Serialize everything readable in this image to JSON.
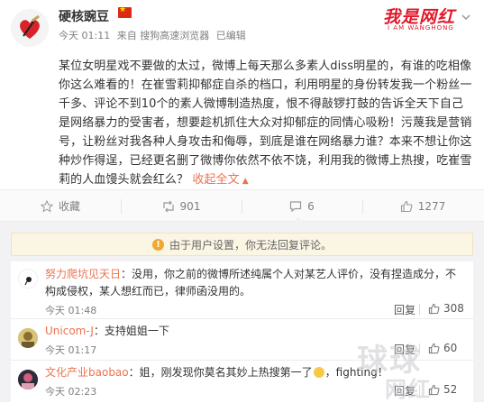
{
  "post": {
    "username": "硬核豌豆",
    "time": "今天 01:11",
    "source": "来自 搜狗高速浏览器",
    "edited": "已编辑",
    "body_main": "某位女明星戏不要做的太过，微博上每天那么多素人diss明星的，有谁的吃相像你这么难看的！在崔雪莉抑郁症自杀的档口，利用明星的身份转发我一个粉丝一千多、评论不到10个的素人微博制造热度，恨不得敲锣打鼓的告诉全天下自己是网络暴力的受害者，想要趁机抓住大众对抑郁症的同情心吸粉！污蔑我是营销号，让粉丝对我各种人身攻击和侮辱，到底是谁在网络暴力谁？本来不想让你这种炒作得逞，已经更名删了微博你依然不依不饶，利用我的微博上热搜，吃崔雪莉的人血馒头就会红么？",
    "collapse_label": "收起全文"
  },
  "watermark": {
    "top": "我是网红",
    "top_sub": "I AM WANGHONG",
    "bottom_line1": "球球",
    "bottom_line2": "网红"
  },
  "actions": {
    "favorite_label": "收藏",
    "repost_count": "901",
    "comment_count": "6",
    "like_count": "1277"
  },
  "notice": {
    "text": "由于用户设置，你无法回复评论。"
  },
  "comments": [
    {
      "user": "努力爬坑见天日",
      "text": "：没用，你之前的微博所述纯属个人对某艺人评价，没有捏造成分，不构成侵权，某人想红而已，律师函没用的。",
      "time": "今天 01:48",
      "reply_label": "回复",
      "likes": "308"
    },
    {
      "user": "Unicom-J",
      "text": "：支持姐姐一下",
      "time": "今天 01:17",
      "reply_label": "回复",
      "likes": "60"
    },
    {
      "user": "文化产业baobao",
      "text_before_emoji": "：姐，刚发现你莫名其妙上热搜第一了",
      "text_after_emoji": "，fighting！",
      "time": "今天 02:23",
      "reply_label": "回复",
      "likes": "52"
    }
  ],
  "colors": {
    "accent": "#eb7350",
    "brand_red": "#e2182a",
    "notice_bg": "#fbf5e4",
    "page_bg": "#f2f2f5"
  },
  "icons": [
    "chevron-down-icon",
    "star-icon",
    "repost-icon",
    "comment-icon",
    "thumbs-up-icon",
    "info-icon"
  ]
}
